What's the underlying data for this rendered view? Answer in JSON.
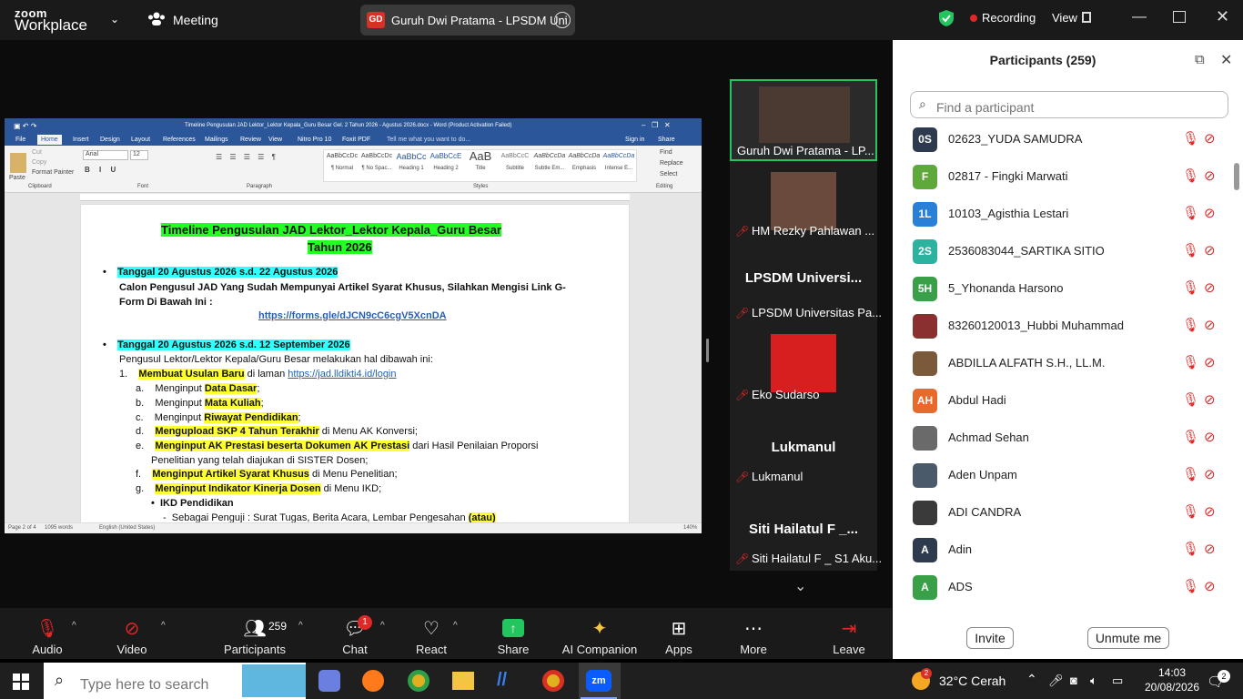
{
  "app": {
    "logo_line1": "zoom",
    "logo_line2": "Workplace",
    "meeting_label": "Meeting"
  },
  "share": {
    "badge": "GD",
    "title": "Guruh Dwi Pratama - LPSDM Uni"
  },
  "status": {
    "recording": "Recording",
    "view": "View"
  },
  "word": {
    "window_title": "Timeline Pengusulan JAD Lektor_Lektor Kepala_Guru Besar Gel. 2 Tahun 2026 - Agustus 2026.docx - Word (Product Activation Failed)",
    "tabs": [
      "File",
      "Home",
      "Insert",
      "Design",
      "Layout",
      "References",
      "Mailings",
      "Review",
      "View",
      "Nitro Pro 10",
      "Foxit PDF",
      "Tell me what you want to do..."
    ],
    "sign_in": "Sign in",
    "share": "Share",
    "font": "Arial",
    "size": "12",
    "groups": [
      "Clipboard",
      "Font",
      "Paragraph",
      "Styles",
      "Editing"
    ],
    "styles": [
      {
        "preview": "AaBbCcDc",
        "name": "¶ Normal"
      },
      {
        "preview": "AaBbCcDc",
        "name": "¶ No Spac..."
      },
      {
        "preview": "AaBbCc",
        "name": "Heading 1"
      },
      {
        "preview": "AaBbCcE",
        "name": "Heading 2"
      },
      {
        "preview": "AaB",
        "name": "Title"
      },
      {
        "preview": "AaBbCcC",
        "name": "Subtitle"
      },
      {
        "preview": "AaBbCcDa",
        "name": "Subtle Em..."
      },
      {
        "preview": "AaBbCcDa",
        "name": "Emphasis"
      },
      {
        "preview": "AaBbCcDa",
        "name": "Intense E..."
      }
    ],
    "editing": [
      "Find",
      "Replace",
      "Select"
    ],
    "clipboard": [
      "Paste",
      "Cut",
      "Copy",
      "Format Painter"
    ],
    "doc": {
      "title1": "Timeline Pengusulan JAD Lektor_Lektor Kepala_Guru Besar",
      "title2": "Tahun 2026",
      "b1": "Tanggal 20 Agustus 2026 s.d. 22 Agustus 2026",
      "b1_text1": "Calon Pengusul JAD Yang Sudah Mempunyai Artikel Syarat Khusus, Silahkan Mengisi Link G-",
      "b1_text2": "Form Di Bawah Ini :",
      "b1_link": "https://forms.gle/dJCN9cC6cgV5XcnDA",
      "b2": "Tanggal 20 Agustus 2026 s.d. 12 September 2026",
      "b2_text": "Pengusul Lektor/Lektor Kepala/Guru Besar melakukan hal dibawah ini:",
      "i1_num": "1.",
      "i1_hl": "Membuat Usulan Baru",
      "i1_mid": " di laman ",
      "i1_link": "https://jad.lldikti4.id/login",
      "a_l": "a.",
      "a_pre": "Menginput ",
      "a_hl": "Data Dasar",
      "a_post": ";",
      "b_l": "b.",
      "b_pre": "Menginput ",
      "b_hl": "Mata Kuliah",
      "b_post": ";",
      "c_l": "c.",
      "c_pre": "Menginput ",
      "c_hl": "Riwayat Pendidikan",
      "c_post": ";",
      "d_l": "d.",
      "d_hl": "Mengupload SKP 4 Tahun Terakhir",
      "d_post": " di Menu AK Konversi;",
      "e_l": "e.",
      "e_hl": "Menginput AK Prestasi beserta Dokumen AK Prestasi",
      "e_post": " dari Hasil Penilaian Proporsi",
      "e_line2": "Penelitian yang telah diajukan di SISTER Dosen;",
      "f_l": "f.",
      "f_hl": "Menginput Artikel Syarat Khusus",
      "f_post": " di Menu Penelitian;",
      "g_l": "g.",
      "g_hl": "Menginput Indikator Kinerja Dosen",
      "g_post": " di Menu IKD;",
      "ikd": "IKD Pendidikan",
      "last_pre": "Sebagai Penguji : Surat Tugas, Berita Acara, Lembar Pengesahan ",
      "last_hl": "(atau)"
    },
    "status_page": "Page 2 of 4",
    "status_words": "1095 words",
    "status_lang": "English (United States)",
    "zoom": "140%"
  },
  "tiles": [
    {
      "name": "Guruh Dwi Pratama - LP...",
      "big": ""
    },
    {
      "name": "HM Rezky Pahlawan ...",
      "big": ""
    },
    {
      "name": "LPSDM Universitas Pa...",
      "big": "LPSDM  Universi..."
    },
    {
      "name": "Eko Sudarso",
      "big": ""
    },
    {
      "name": "Lukmanul",
      "big": "Lukmanul"
    },
    {
      "name": "Siti Hailatul F _ S1 Aku...",
      "big": "Siti Hailatul F _..."
    }
  ],
  "participants": {
    "title": "Participants (259)",
    "search_placeholder": "Find a participant",
    "list": [
      {
        "av": "0S",
        "color": "#2e3a4e",
        "name": "02623_YUDA SAMUDRA"
      },
      {
        "av": "F",
        "color": "#5fa83a",
        "name": "02817 - Fingki Marwati"
      },
      {
        "av": "1L",
        "color": "#2a7fd6",
        "name": "10103_Agisthia Lestari"
      },
      {
        "av": "2S",
        "color": "#2bb3a0",
        "name": "2536083044_SARTIKA SITIO"
      },
      {
        "av": "5H",
        "color": "#3aa048",
        "name": "5_Yhonanda Harsono"
      },
      {
        "av": "",
        "color": "#8a3030",
        "name": "83260120013_Hubbi Muhammad"
      },
      {
        "av": "",
        "color": "#7a5a3a",
        "name": "ABDILLA ALFATH S.H., LL.M."
      },
      {
        "av": "AH",
        "color": "#e86a2a",
        "name": "Abdul Hadi"
      },
      {
        "av": "",
        "color": "#6a6a6a",
        "name": "Achmad Sehan"
      },
      {
        "av": "",
        "color": "#4a5a6a",
        "name": "Aden Unpam"
      },
      {
        "av": "",
        "color": "#3a3a3a",
        "name": "ADI CANDRA"
      },
      {
        "av": "A",
        "color": "#2e3a4e",
        "name": "Adin"
      },
      {
        "av": "A",
        "color": "#3aa048",
        "name": "ADS"
      }
    ],
    "invite": "Invite",
    "unmute": "Unmute me"
  },
  "toolbar": {
    "audio": "Audio",
    "video": "Video",
    "participants": "Participants",
    "participants_count": "259",
    "chat": "Chat",
    "chat_badge": "1",
    "react": "React",
    "share": "Share",
    "ai": "AI Companion",
    "apps": "Apps",
    "more": "More",
    "leave": "Leave"
  },
  "taskbar": {
    "search_placeholder": "Type here to search",
    "weather_badge": "2",
    "weather": "32°C  Cerah",
    "time": "14:03",
    "date": "20/08/2026",
    "notif_badge": "2"
  },
  "colors": {
    "zoom_blue": "#0b5cff",
    "recording": "#e02828",
    "word_blue": "#2b579a",
    "share_green": "#22c55e"
  }
}
